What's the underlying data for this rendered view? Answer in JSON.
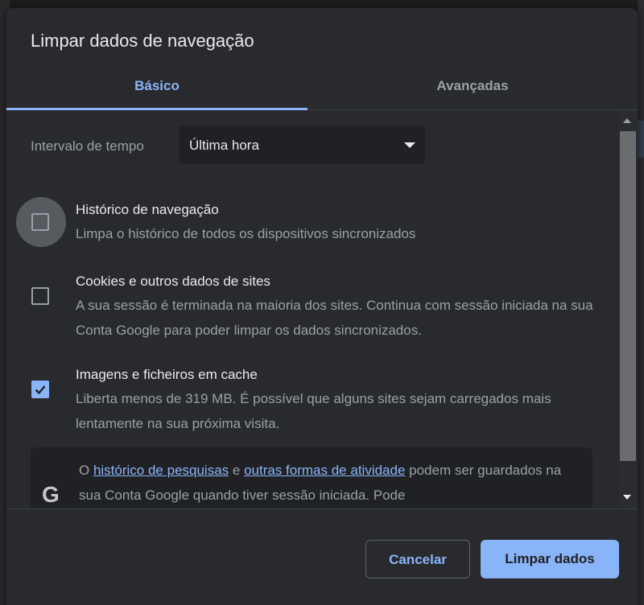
{
  "dialog": {
    "title": "Limpar dados de navegação"
  },
  "tabs": [
    {
      "label": "Básico",
      "active": true
    },
    {
      "label": "Avançadas",
      "active": false
    }
  ],
  "time_range": {
    "label": "Intervalo de tempo",
    "selected": "Última hora"
  },
  "options": [
    {
      "title": "Histórico de navegação",
      "description": "Limpa o histórico de todos os dispositivos sincronizados",
      "checked": false
    },
    {
      "title": "Cookies e outros dados de sites",
      "description": "A sua sessão é terminada na maioria dos sites. Continua com sessão iniciada na sua Conta Google para poder limpar os dados sincronizados.",
      "checked": false
    },
    {
      "title": "Imagens e ficheiros em cache",
      "description": "Liberta menos de 319 MB. É possível que alguns sites sejam carregados mais lentamente na sua próxima visita.",
      "checked": true
    }
  ],
  "info": {
    "icon": "google-g-icon",
    "prefix": "O ",
    "link1": "histórico de pesquisas",
    "middle": " e ",
    "link2": "outras formas de atividade",
    "suffix": " podem ser guardados na sua Conta Google quando tiver sessão iniciada. Pode"
  },
  "buttons": {
    "cancel": "Cancelar",
    "clear": "Limpar dados"
  },
  "colors": {
    "accent": "#8ab4f8",
    "dialog_bg": "#292a2d"
  }
}
